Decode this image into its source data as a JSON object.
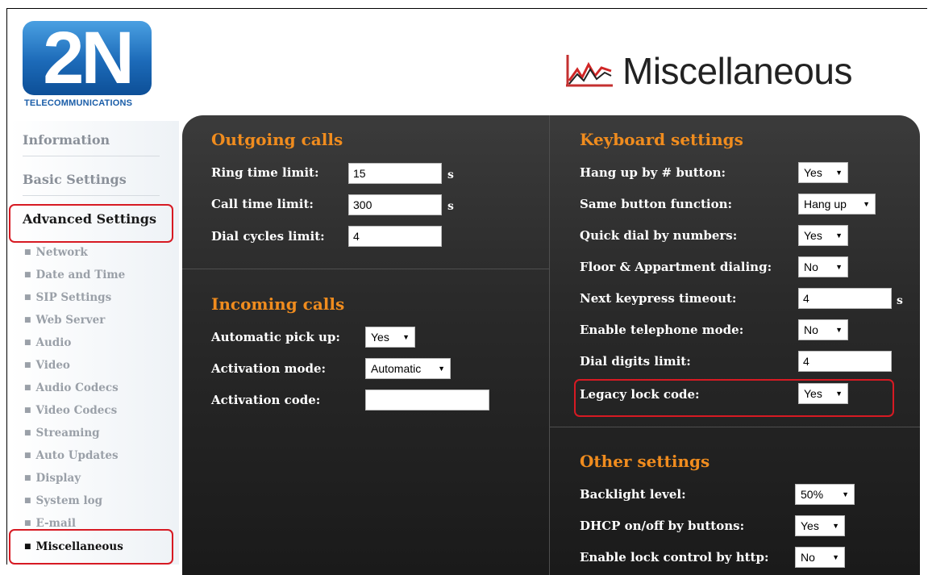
{
  "logo": {
    "text": "2N",
    "subtitle": "TELECOMMUNICATIONS"
  },
  "page": {
    "title": "Miscellaneous",
    "icon": "chart-line-icon"
  },
  "sidebar": {
    "top_items": [
      {
        "label": "Information"
      },
      {
        "label": "Basic Settings"
      },
      {
        "label": "Advanced Settings"
      }
    ],
    "sub_items": [
      {
        "label": "Network"
      },
      {
        "label": "Date and Time"
      },
      {
        "label": "SIP Settings"
      },
      {
        "label": "Web Server"
      },
      {
        "label": "Audio"
      },
      {
        "label": "Video"
      },
      {
        "label": "Audio Codecs"
      },
      {
        "label": "Video Codecs"
      },
      {
        "label": "Streaming"
      },
      {
        "label": "Auto Updates"
      },
      {
        "label": "Display"
      },
      {
        "label": "System log"
      },
      {
        "label": "E-mail"
      },
      {
        "label": "Miscellaneous"
      }
    ],
    "bullet": "■"
  },
  "outgoing": {
    "title": "Outgoing calls",
    "ring_label": "Ring time limit:",
    "ring_value": "15",
    "ring_unit": "s",
    "call_label": "Call time limit:",
    "call_value": "300",
    "call_unit": "s",
    "dial_label": "Dial cycles limit:",
    "dial_value": "4"
  },
  "incoming": {
    "title": "Incoming calls",
    "pickup_label": "Automatic pick up:",
    "pickup_value": "Yes",
    "mode_label": "Activation mode:",
    "mode_value": "Automatic",
    "code_label": "Activation code:",
    "code_value": ""
  },
  "keyboard": {
    "title": "Keyboard settings",
    "hangup_label": "Hang up by # button:",
    "hangup_value": "Yes",
    "same_label": "Same button function:",
    "same_value": "Hang up",
    "quick_label": "Quick dial by numbers:",
    "quick_value": "Yes",
    "floor_label": "Floor & Appartment dialing:",
    "floor_value": "No",
    "next_label": "Next keypress timeout:",
    "next_value": "4",
    "next_unit": "s",
    "tel_label": "Enable telephone mode:",
    "tel_value": "No",
    "digits_label": "Dial digits limit:",
    "digits_value": "4",
    "legacy_label": "Legacy lock code:",
    "legacy_value": "Yes"
  },
  "other": {
    "title": "Other settings",
    "backlight_label": "Backlight level:",
    "backlight_value": "50%",
    "dhcp_label": "DHCP on/off by buttons:",
    "dhcp_value": "Yes",
    "lock_label": "Enable lock control by http:",
    "lock_value": "No"
  },
  "caret": "▼",
  "colors": {
    "accent": "#f08c1e",
    "highlight": "#d71a23",
    "brand": "#1c6ab8"
  }
}
